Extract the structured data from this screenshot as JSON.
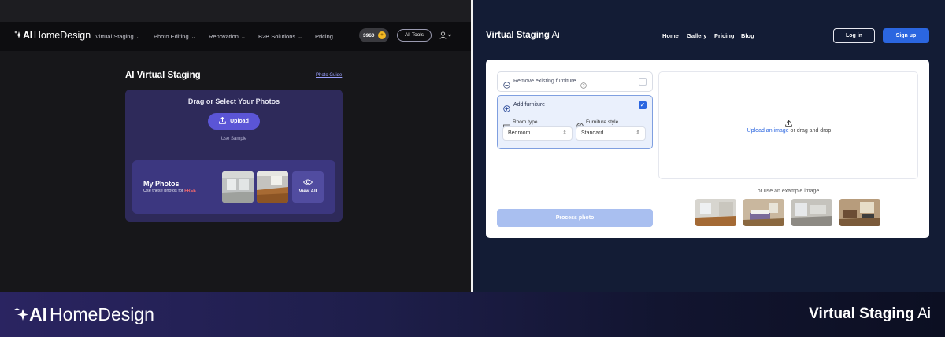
{
  "left": {
    "brand": {
      "ai": "AI",
      "rest": "HomeDesign"
    },
    "nav": [
      {
        "label": "Virtual Staging",
        "has_dropdown": true
      },
      {
        "label": "Photo Editing",
        "has_dropdown": true
      },
      {
        "label": "Renovation",
        "has_dropdown": true
      },
      {
        "label": "B2B Solutions",
        "has_dropdown": true
      },
      {
        "label": "Pricing",
        "has_dropdown": false
      }
    ],
    "credits": "3960",
    "all_tools": "All Tools",
    "page_title": "AI Virtual Staging",
    "photo_guide": "Photo Guide",
    "upload_card": {
      "heading": "Drag or Select Your Photos",
      "upload_label": "Upload",
      "use_sample": "Use Sample"
    },
    "my_photos": {
      "title": "My Photos",
      "subtitle_prefix": "Use these photos for ",
      "subtitle_free": "FREE",
      "view_all": "View All"
    },
    "colors": {
      "accent": "#5b55d6",
      "card": "#2e2a5a",
      "free": "#ff6a6a"
    }
  },
  "right": {
    "brand": {
      "bold": "Virtual Staging",
      "light": "Ai"
    },
    "nav": [
      "Home",
      "Gallery",
      "Pricing",
      "Blog"
    ],
    "login": "Log in",
    "signup": "Sign up",
    "options": {
      "remove_label": "Remove existing furniture",
      "remove_checked": false,
      "add_label": "Add furniture",
      "add_checked": true,
      "room_type_label": "Room type",
      "room_type_value": "Bedroom",
      "furniture_style_label": "Furniture style",
      "furniture_style_value": "Standard"
    },
    "process_button": "Process photo",
    "dropzone": {
      "link": "Upload an image",
      "rest": " or drag and drop"
    },
    "example_label": "or use an example image",
    "colors": {
      "accent": "#2b66e0",
      "bg": "#131c35"
    }
  },
  "footer": {
    "left_brand": {
      "ai": "AI",
      "rest": "HomeDesign"
    },
    "right_brand": {
      "bold": "Virtual Staging",
      "light": "Ai"
    }
  }
}
